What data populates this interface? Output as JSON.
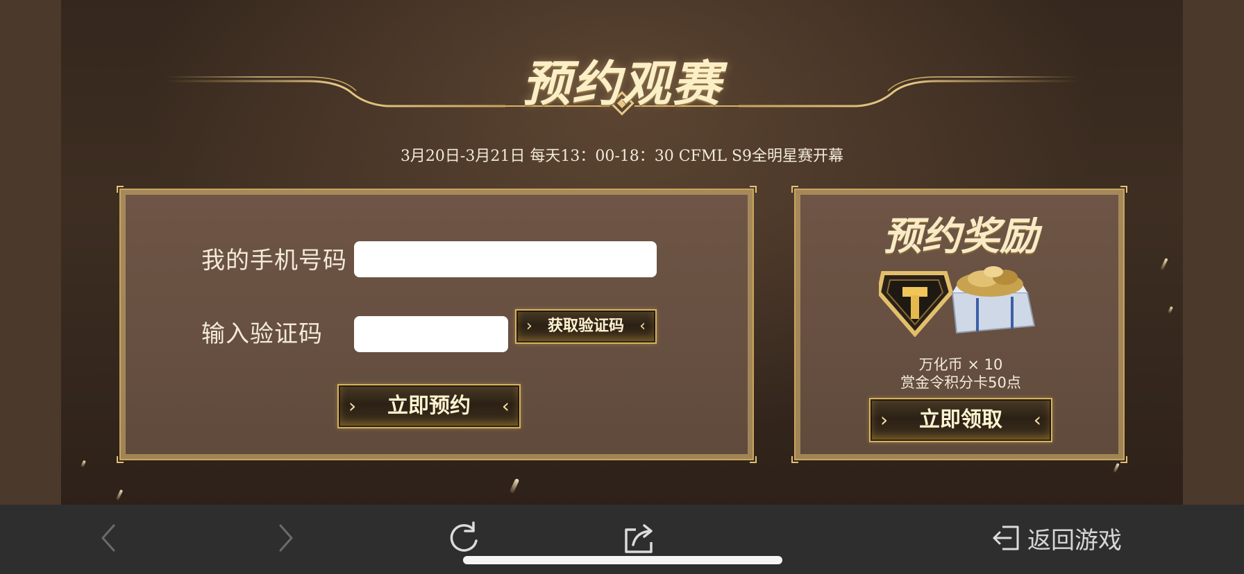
{
  "main": {
    "title": "预约观赛",
    "schedule": "3月20日-3月21日 每天13：00-18：30 CFML S9全明星赛开幕"
  },
  "form": {
    "phone_label": "我的手机号码",
    "phone_value": "",
    "code_label": "输入验证码",
    "code_value": "",
    "get_code_button": "获取验证码",
    "submit_button": "立即预约"
  },
  "reward": {
    "title": "预约奖励",
    "item_1": "万化币 × 10",
    "item_2": "赏金令积分卡50点",
    "claim_button": "立即领取"
  },
  "toolbar": {
    "back_icon": "chevron-left-icon",
    "forward_icon": "chevron-right-icon",
    "refresh_icon": "refresh-icon",
    "share_icon": "share-icon",
    "return_icon": "exit-icon",
    "return_label": "返回游戏"
  },
  "colors": {
    "gold": "#c9a55c",
    "panel": "#6e5546",
    "toolbar": "#2e2e2e"
  }
}
